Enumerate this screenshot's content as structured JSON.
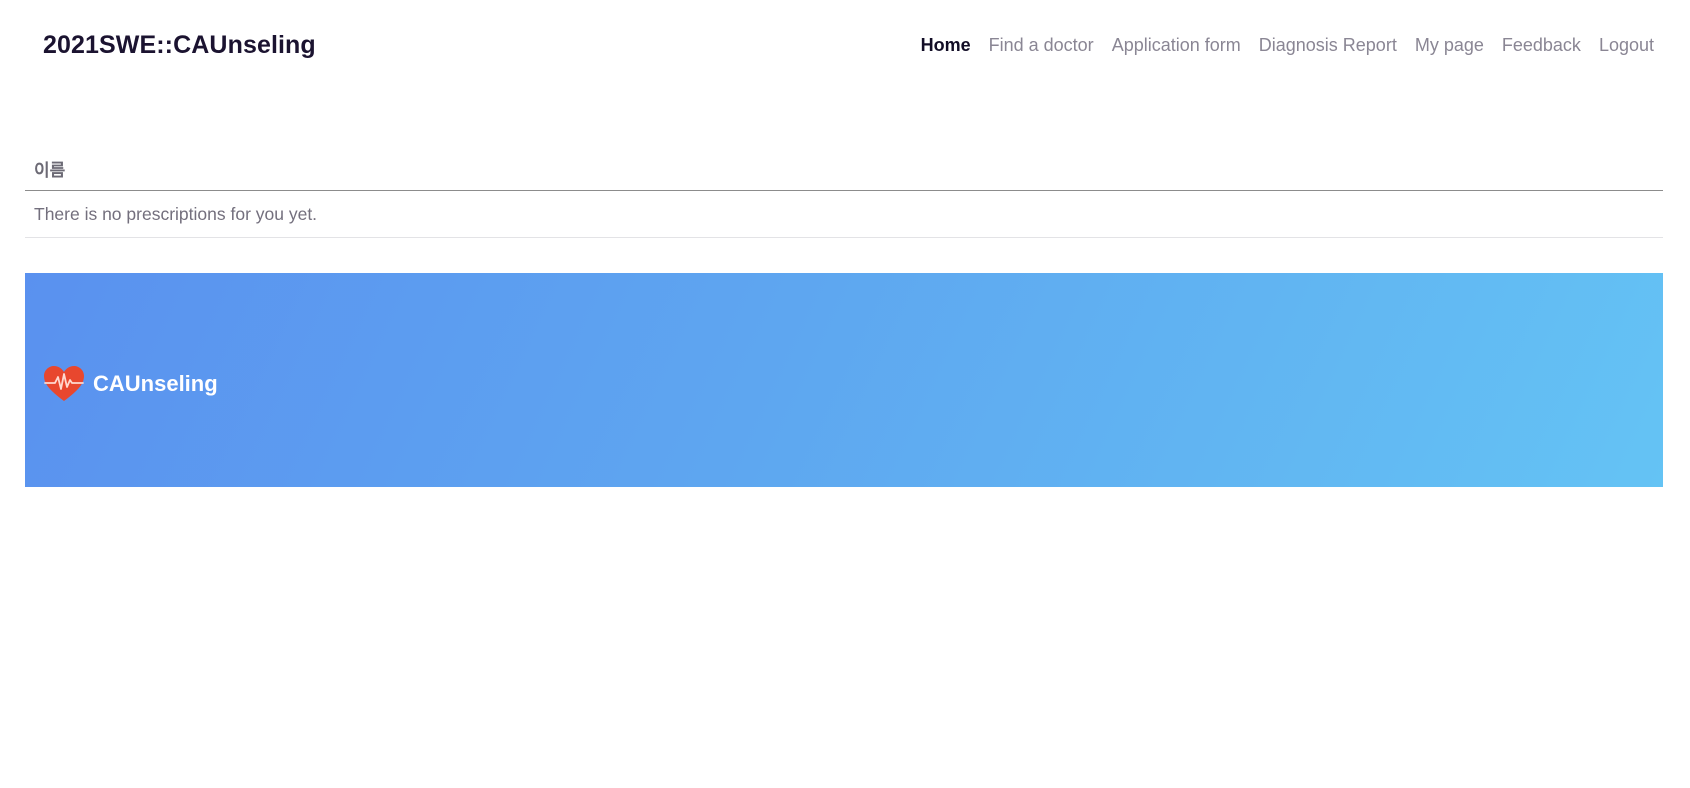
{
  "header": {
    "brand": "2021SWE::CAUnseling",
    "nav": [
      {
        "label": "Home",
        "active": true
      },
      {
        "label": "Find a doctor",
        "active": false
      },
      {
        "label": "Application form",
        "active": false
      },
      {
        "label": "Diagnosis Report",
        "active": false
      },
      {
        "label": "My page",
        "active": false
      },
      {
        "label": "Feedback",
        "active": false
      },
      {
        "label": "Logout",
        "active": false
      }
    ]
  },
  "table": {
    "columns": [
      "이름"
    ],
    "empty_message": "There is no prescriptions for you yet."
  },
  "footer": {
    "logo_icon": "heart-pulse-icon",
    "brand": "CAUnseling",
    "logo_color": "#e8472e",
    "gradient_start": "#5a91ef",
    "gradient_end": "#64c3f4"
  }
}
